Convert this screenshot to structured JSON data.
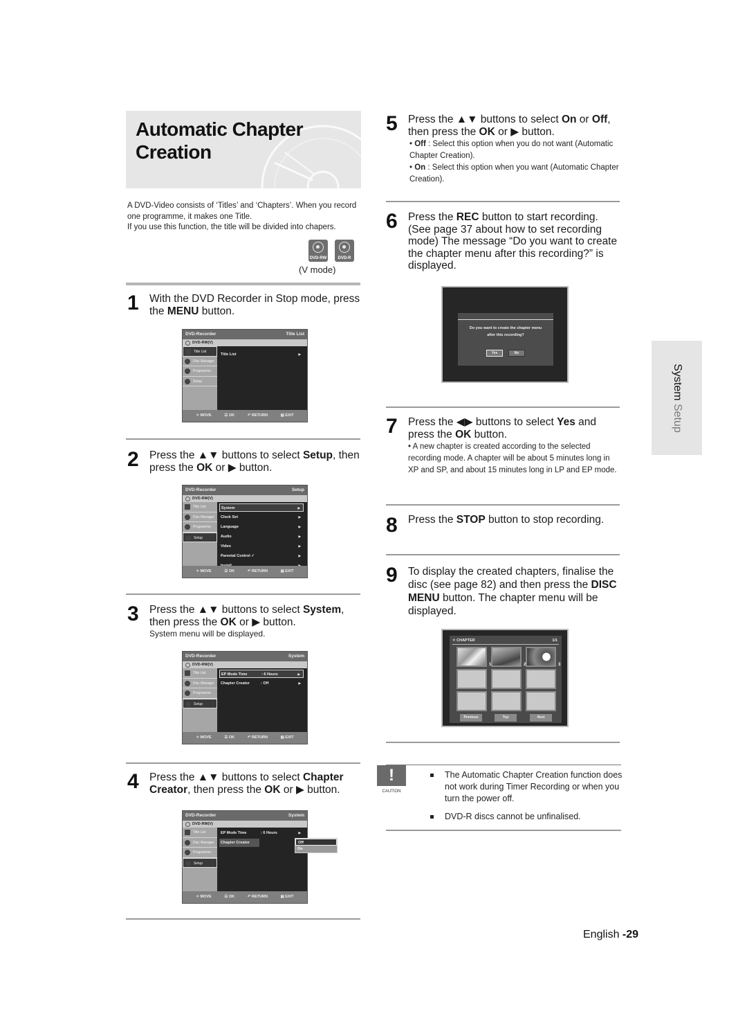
{
  "title": {
    "line1": "Automatic Chapter",
    "line2": "Creation"
  },
  "intro": {
    "p1": "A DVD-Video consists of ‘Titles’ and ‘Chapters’. When you record one programme, it makes one Title.",
    "p2": "If you use this function, the title will be divided into chapers."
  },
  "badges": [
    "DVD-RW",
    "DVD-R"
  ],
  "vmode": "(V mode)",
  "steps": {
    "s1": {
      "num": "1",
      "a": "With the DVD Recorder in Stop mode, press the ",
      "b": "MENU",
      "c": " button."
    },
    "s2": {
      "num": "2",
      "a": "Press the ▲▼ buttons to select ",
      "b": "Setup",
      "c": ", then press the ",
      "d": "OK",
      "e": " or ▶ button."
    },
    "s3": {
      "num": "3",
      "a": "Press the ▲▼ buttons to select ",
      "b": "System",
      "c": ", then press the ",
      "d": "OK",
      "e": " or ▶ button.",
      "sub": "System menu will be displayed."
    },
    "s4": {
      "num": "4",
      "a": "Press the ▲▼ buttons to select ",
      "b": "Chapter Creator",
      "c": ", then press the ",
      "d": "OK",
      "e": " or ▶ button."
    },
    "s5": {
      "num": "5",
      "a": "Press the ▲▼ buttons to select ",
      "b": "On",
      "c": " or ",
      "d": "Off",
      "e": ", then press the ",
      "f": "OK",
      "g": " or ▶ button.",
      "off_label": "Off",
      "off_text": ": Select this option when you do not want (Automatic Chapter Creation).",
      "on_label": "On",
      "on_text": ": Select this option when you want (Automatic Chapter Creation)."
    },
    "s6": {
      "num": "6",
      "a": "Press the ",
      "b": "REC",
      "c": " button to start recording. (See page 37 about how to set recording mode) The message “Do you want to create the chapter menu after this recording?” is displayed."
    },
    "s7": {
      "num": "7",
      "a": "Press the ◀▶ buttons to select ",
      "b": "Yes",
      "c": " and press the ",
      "d": "OK",
      "e": " button.",
      "sub": "• A new chapter is created according to the selected recording mode. A chapter will be about 5 minutes long in XP and SP, and about 15 minutes long in LP and EP mode."
    },
    "s8": {
      "num": "8",
      "a": "Press the ",
      "b": "STOP",
      "c": " button to stop recording."
    },
    "s9": {
      "num": "9",
      "a": "To display the created chapters, finalise the disc (see page 82) and then press the ",
      "b": "DISC MENU",
      "c": " button. The chapter menu will be displayed."
    }
  },
  "osd": {
    "brand": "DVD-Recorder",
    "disc": "DVD-RW(V)",
    "sidebar": [
      "Title List",
      "Disc Manager",
      "Programme",
      "Setup"
    ],
    "footer": [
      "✧ MOVE",
      "☰ OK",
      "↶ RETURN",
      "▤ EXIT"
    ],
    "screen1": {
      "section": "Title List",
      "rows": [
        {
          "label": "Title List",
          "arrow": "▶"
        }
      ]
    },
    "screen2": {
      "section": "Setup",
      "rows": [
        {
          "label": "System",
          "arrow": "▶"
        },
        {
          "label": "Clock Set",
          "arrow": "▶"
        },
        {
          "label": "Language",
          "arrow": "▶"
        },
        {
          "label": "Audio",
          "arrow": "▶"
        },
        {
          "label": "Video",
          "arrow": "▶"
        },
        {
          "label": "Parental Control ✓",
          "arrow": "▶"
        },
        {
          "label": "Install",
          "arrow": "▶"
        }
      ]
    },
    "screen3": {
      "section": "System",
      "rows": [
        {
          "label": "EP Mode Time",
          "value": ": 6 Hours",
          "arrow": "▶"
        },
        {
          "label": "Chapter Creator",
          "value": ": Off",
          "arrow": "▶"
        }
      ]
    },
    "screen4": {
      "section": "System",
      "rows": [
        {
          "label": "EP Mode Time",
          "value": ": 6 Hours",
          "arrow": "▶"
        },
        {
          "label": "Chapter Creator"
        }
      ],
      "options": [
        "Off",
        "On"
      ]
    }
  },
  "dialog": {
    "line1": "Do you want to create the chapter menu",
    "line2": "after this recording?",
    "yes": "Yes",
    "no": "No"
  },
  "chapter_menu": {
    "title": "✧ CHAPTER",
    "page": "1/1",
    "thumb_numbers": [
      "1",
      "2",
      "3"
    ],
    "buttons": [
      "Previous",
      "Top",
      "Next"
    ]
  },
  "side_tab": {
    "bold": "System",
    "rest": " Setup"
  },
  "caution": {
    "icon": "!",
    "label": "CAUTION",
    "items": [
      "The Automatic Chapter Creation function does not work during Timer Recording or when you turn the power off.",
      "DVD-R discs cannot be unfinalised."
    ]
  },
  "page": {
    "lang": "English ",
    "num": "-29"
  }
}
